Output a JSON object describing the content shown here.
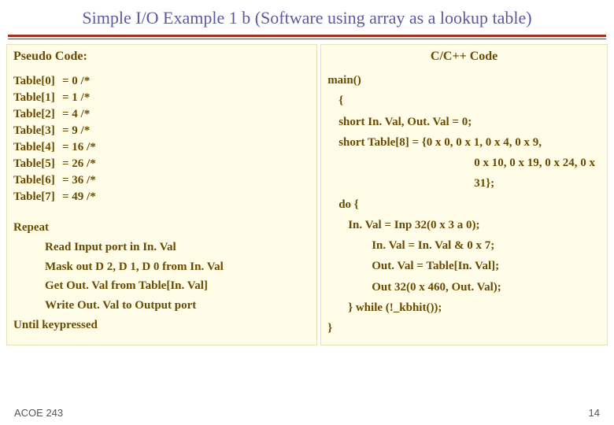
{
  "title": "Simple I/O Example 1 b (Software using array as a lookup table)",
  "left": {
    "heading": "Pseudo Code:",
    "table": [
      {
        "key": "Table[0]",
        "val": "=  0   /*"
      },
      {
        "key": "Table[1]",
        "val": "=  1   /*"
      },
      {
        "key": "Table[2]",
        "val": "=  4   /*"
      },
      {
        "key": "Table[3]",
        "val": "=  9   /*"
      },
      {
        "key": "Table[4]",
        "val": "=  16  /*"
      },
      {
        "key": "Table[5]",
        "val": "=  26  /*"
      },
      {
        "key": "Table[6]",
        "val": "=  36  /*"
      },
      {
        "key": "Table[7]",
        "val": "=  49  /*"
      }
    ],
    "repeat_top": "Repeat",
    "repeat_lines": [
      "Read Input port in In. Val",
      "Mask out D 2, D 1, D 0 from In. Val",
      "Get Out. Val from  Table[In. Val]",
      "Write Out. Val to Output port"
    ],
    "repeat_end": "Until keypressed"
  },
  "right": {
    "heading": "C/C++ Code",
    "lines": {
      "l0": "main()",
      "l1": "{",
      "l2": "short In. Val, Out. Val = 0;",
      "l3": "short Table[8] = {0 x 0, 0 x 1, 0 x 4, 0 x 9,",
      "l4": "0 x 10, 0 x 19, 0 x 24, 0 x 31};",
      "l5": "do {",
      "l6": "In. Val = Inp 32(0 x 3 a 0);",
      "l7": "In. Val = In. Val & 0 x 7;",
      "l8": "Out. Val =  Table[In. Val];",
      "l9": "Out 32(0 x 460, Out. Val);",
      "l10": "} while (!_kbhit());",
      "l11": "}"
    }
  },
  "footer": {
    "left": "ACOE 243",
    "right": "14"
  }
}
